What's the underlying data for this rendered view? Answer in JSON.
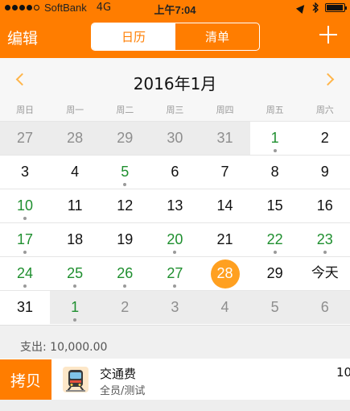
{
  "status_bar": {
    "carrier": "SoftBank",
    "network": "4G",
    "time": "上午7:04",
    "signal_dots": 4,
    "battery_level": 0.95,
    "icons": [
      "location-arrow-icon",
      "bluetooth-icon",
      "battery-icon"
    ]
  },
  "nav": {
    "edit_label": "编辑",
    "tabs": [
      {
        "label": "日历",
        "active": true
      },
      {
        "label": "清单",
        "active": false
      }
    ],
    "add_icon": "plus-icon"
  },
  "calendar": {
    "month_title": "2016年1月",
    "weekdays": [
      "周日",
      "周一",
      "周二",
      "周三",
      "周四",
      "周五",
      "周六"
    ],
    "weeks": [
      [
        {
          "label": "27",
          "other": true,
          "color": "grey",
          "marker": false
        },
        {
          "label": "28",
          "other": true,
          "color": "grey",
          "marker": false
        },
        {
          "label": "29",
          "other": true,
          "color": "grey",
          "marker": false
        },
        {
          "label": "30",
          "other": true,
          "color": "grey",
          "marker": false
        },
        {
          "label": "31",
          "other": true,
          "color": "grey",
          "marker": false
        },
        {
          "label": "1",
          "other": false,
          "color": "green",
          "marker": true
        },
        {
          "label": "2",
          "other": false,
          "color": "black",
          "marker": false
        }
      ],
      [
        {
          "label": "3",
          "other": false,
          "color": "black",
          "marker": false
        },
        {
          "label": "4",
          "other": false,
          "color": "black",
          "marker": false
        },
        {
          "label": "5",
          "other": false,
          "color": "green",
          "marker": true
        },
        {
          "label": "6",
          "other": false,
          "color": "black",
          "marker": false
        },
        {
          "label": "7",
          "other": false,
          "color": "black",
          "marker": false
        },
        {
          "label": "8",
          "other": false,
          "color": "black",
          "marker": false
        },
        {
          "label": "9",
          "other": false,
          "color": "black",
          "marker": false
        }
      ],
      [
        {
          "label": "10",
          "other": false,
          "color": "green",
          "marker": true
        },
        {
          "label": "11",
          "other": false,
          "color": "black",
          "marker": false
        },
        {
          "label": "12",
          "other": false,
          "color": "black",
          "marker": false
        },
        {
          "label": "13",
          "other": false,
          "color": "black",
          "marker": false
        },
        {
          "label": "14",
          "other": false,
          "color": "black",
          "marker": false
        },
        {
          "label": "15",
          "other": false,
          "color": "black",
          "marker": false
        },
        {
          "label": "16",
          "other": false,
          "color": "black",
          "marker": false
        }
      ],
      [
        {
          "label": "17",
          "other": false,
          "color": "green",
          "marker": true
        },
        {
          "label": "18",
          "other": false,
          "color": "black",
          "marker": false
        },
        {
          "label": "19",
          "other": false,
          "color": "black",
          "marker": false
        },
        {
          "label": "20",
          "other": false,
          "color": "green",
          "marker": true
        },
        {
          "label": "21",
          "other": false,
          "color": "black",
          "marker": false
        },
        {
          "label": "22",
          "other": false,
          "color": "green",
          "marker": true
        },
        {
          "label": "23",
          "other": false,
          "color": "green",
          "marker": true
        }
      ],
      [
        {
          "label": "24",
          "other": false,
          "color": "green",
          "marker": true
        },
        {
          "label": "25",
          "other": false,
          "color": "green",
          "marker": true
        },
        {
          "label": "26",
          "other": false,
          "color": "green",
          "marker": true
        },
        {
          "label": "27",
          "other": false,
          "color": "green",
          "marker": true
        },
        {
          "label": "28",
          "other": false,
          "color": "white",
          "marker": false,
          "selected": true
        },
        {
          "label": "29",
          "other": false,
          "color": "black",
          "marker": false
        },
        {
          "label": "今天",
          "other": false,
          "color": "black",
          "marker": false,
          "today": true
        }
      ],
      [
        {
          "label": "31",
          "other": false,
          "color": "black",
          "marker": false
        },
        {
          "label": "1",
          "other": true,
          "color": "green",
          "marker": true
        },
        {
          "label": "2",
          "other": true,
          "color": "grey",
          "marker": false
        },
        {
          "label": "3",
          "other": true,
          "color": "grey",
          "marker": false
        },
        {
          "label": "4",
          "other": true,
          "color": "grey",
          "marker": false
        },
        {
          "label": "5",
          "other": true,
          "color": "grey",
          "marker": false
        },
        {
          "label": "6",
          "other": true,
          "color": "grey",
          "marker": false
        }
      ]
    ]
  },
  "summary": {
    "label": "支出: 10,000.00"
  },
  "entry": {
    "copy_label": "拷贝",
    "icon": "train-icon",
    "title": "交通费",
    "subtitle": "全员/测试",
    "amount": "10"
  },
  "colors": {
    "accent": "#ff7d00",
    "green": "#1f8f2f",
    "selected": "#ffa020"
  }
}
